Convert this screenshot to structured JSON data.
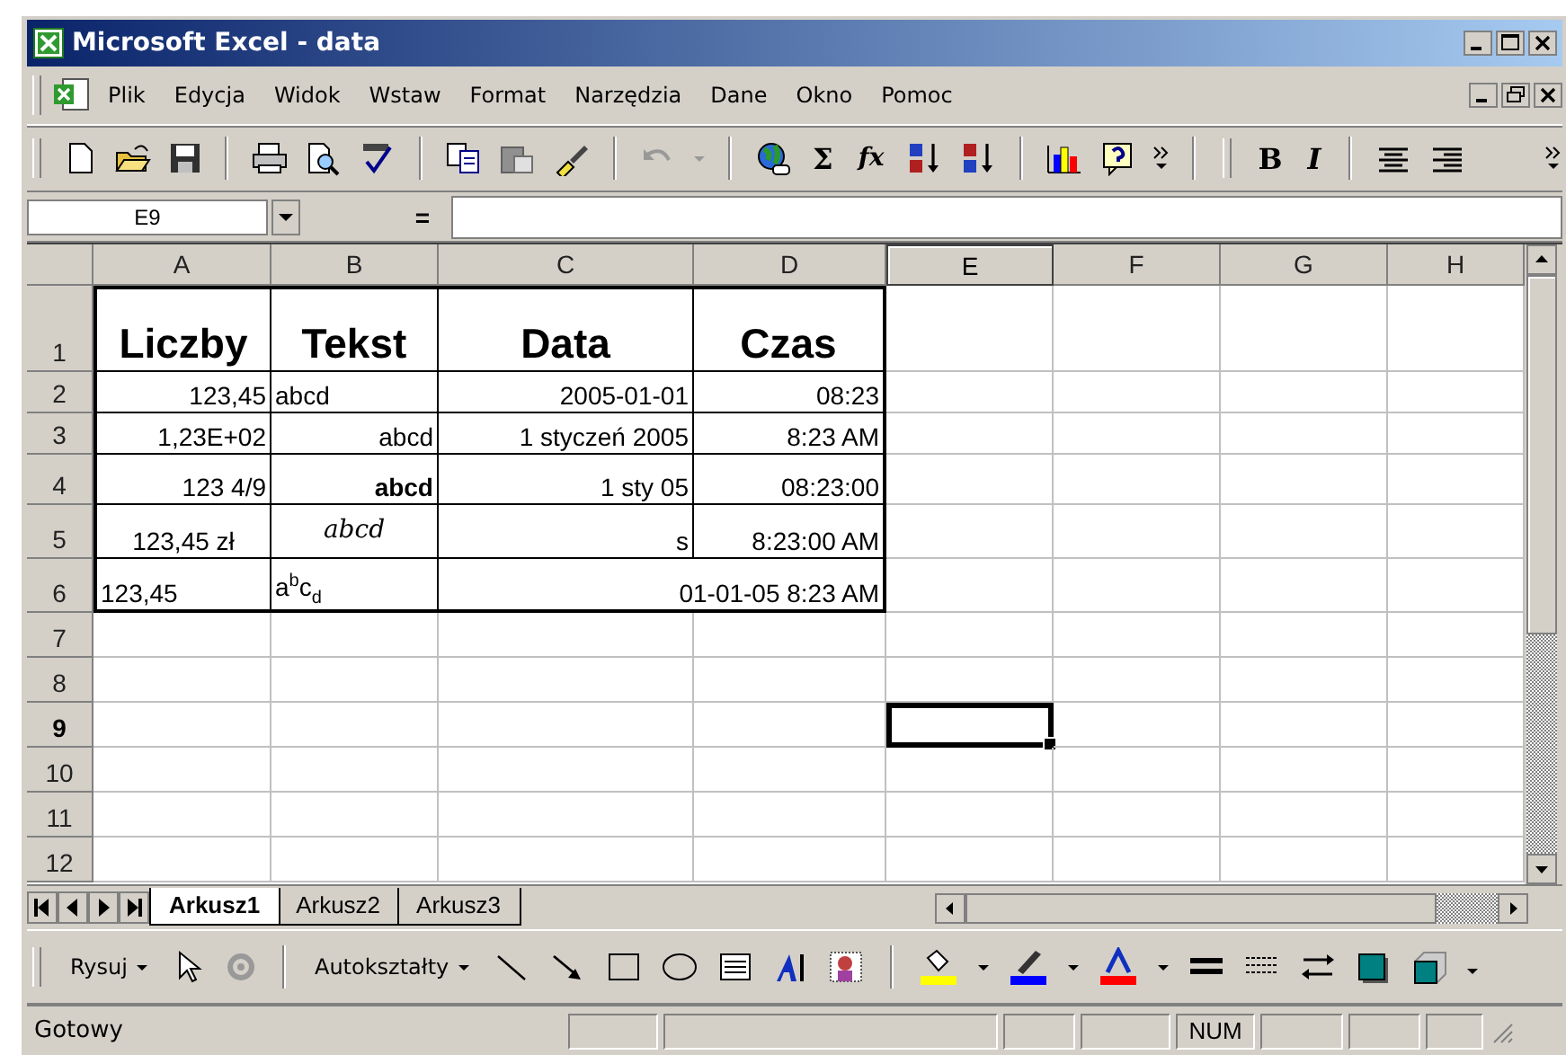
{
  "window": {
    "title": "Microsoft Excel - data"
  },
  "menu": [
    "Plik",
    "Edycja",
    "Widok",
    "Wstaw",
    "Format",
    "Narzędzia",
    "Dane",
    "Okno",
    "Pomoc"
  ],
  "toolbar": {
    "sum": "Σ",
    "function": "fx",
    "bold": "B",
    "italic": "I"
  },
  "formula_bar": {
    "name_box": "E9",
    "equals": "="
  },
  "sheet": {
    "columns": [
      {
        "label": "A",
        "selected": false
      },
      {
        "label": "B",
        "selected": false
      },
      {
        "label": "C",
        "selected": false
      },
      {
        "label": "D",
        "selected": false
      },
      {
        "label": "E",
        "selected": true
      },
      {
        "label": "F",
        "selected": false
      },
      {
        "label": "G",
        "selected": false
      },
      {
        "label": "H",
        "selected": false
      }
    ],
    "rows": [
      {
        "label": "1",
        "selected": false,
        "cells": [
          {
            "text": "Liczby",
            "kind": "heading"
          },
          {
            "text": "Tekst",
            "kind": "heading"
          },
          {
            "text": "Data",
            "kind": "heading"
          },
          {
            "text": "Czas",
            "kind": "heading"
          }
        ]
      },
      {
        "label": "2",
        "selected": false,
        "cells": [
          {
            "text": "123,45",
            "kind": "right"
          },
          {
            "text": "abcd",
            "kind": "left"
          },
          {
            "text": "2005-01-01",
            "kind": "right"
          },
          {
            "text": "08:23",
            "kind": "right"
          }
        ]
      },
      {
        "label": "3",
        "selected": false,
        "cells": [
          {
            "text": "1,23E+02",
            "kind": "right"
          },
          {
            "text": "abcd",
            "kind": "right"
          },
          {
            "text": "1 styczeń 2005",
            "kind": "right"
          },
          {
            "text": "8:23 AM",
            "kind": "right"
          }
        ]
      },
      {
        "label": "4",
        "selected": false,
        "cells": [
          {
            "text": "123 4/9",
            "kind": "right"
          },
          {
            "text": "abcd",
            "kind": "bold"
          },
          {
            "text": "1 sty 05",
            "kind": "right"
          },
          {
            "text": "08:23:00",
            "kind": "right"
          }
        ]
      },
      {
        "label": "5",
        "selected": false,
        "cells": [
          {
            "text": "123,45 zł",
            "kind": "center"
          },
          {
            "text": "abcd",
            "kind": "italic"
          },
          {
            "text": "s",
            "kind": "right"
          },
          {
            "text": "8:23:00 AM",
            "kind": "right"
          }
        ]
      },
      {
        "label": "6",
        "selected": false,
        "cells": [
          {
            "text": "123,45",
            "kind": "left"
          },
          {
            "text": "a$^{b}$c$_{d}$",
            "kind": "left"
          },
          {
            "text": "01-01-05 8:23 AM",
            "kind": "merged"
          }
        ]
      },
      {
        "label": "7",
        "selected": false
      },
      {
        "label": "8",
        "selected": false
      },
      {
        "label": "9",
        "selected": true
      },
      {
        "label": "10",
        "selected": false
      },
      {
        "label": "11",
        "selected": false
      },
      {
        "label": "12",
        "selected": false
      }
    ]
  },
  "sheet_tabs": [
    {
      "label": "Arkusz1",
      "selected": true
    },
    {
      "label": "Arkusz2",
      "selected": false
    },
    {
      "label": "Arkusz3",
      "selected": false
    }
  ],
  "drawing_toolbar": {
    "draw_menu": "Rysuj",
    "autoshapes_menu": "Autokształty"
  },
  "status_bar": {
    "text": "Gotowy",
    "indicators": [
      "NUM"
    ]
  }
}
